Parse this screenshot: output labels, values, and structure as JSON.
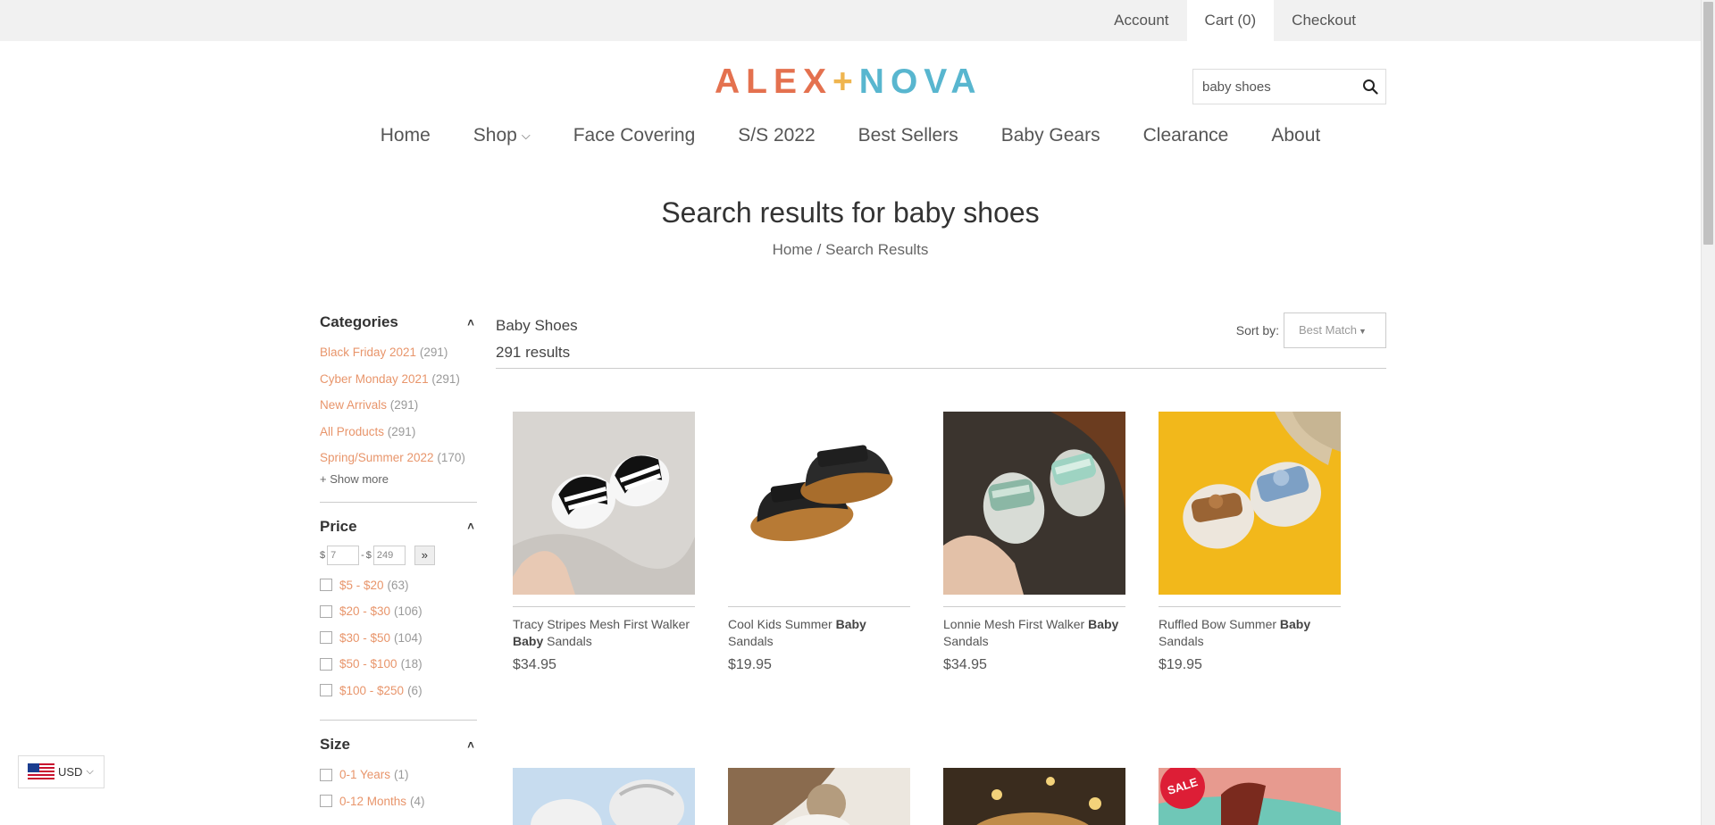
{
  "topbar": {
    "account": "Account",
    "cart": "Cart (0)",
    "checkout": "Checkout"
  },
  "logo": {
    "part1": "ALEX",
    "plus": "+",
    "part2": "NOVA"
  },
  "search": {
    "value": "baby shoes",
    "icon": "search-icon"
  },
  "nav": {
    "items": [
      "Home",
      "Shop",
      "Face Covering",
      "S/S 2022",
      "Best Sellers",
      "Baby Gears",
      "Clearance",
      "About"
    ],
    "shop_chevron": "⌵"
  },
  "page": {
    "title": "Search results for baby shoes",
    "breadcrumb_home": "Home",
    "breadcrumb_sep": " / ",
    "breadcrumb_current": "Search Results"
  },
  "sidebar": {
    "categories": {
      "title": "Categories",
      "items": [
        {
          "label": "Black Friday 2021",
          "count": "(291)"
        },
        {
          "label": "Cyber Monday 2021",
          "count": "(291)"
        },
        {
          "label": "New Arrivals",
          "count": "(291)"
        },
        {
          "label": "All Products",
          "count": "(291)"
        },
        {
          "label": "Spring/Summer 2022",
          "count": "(170)"
        }
      ],
      "show_more": "+ Show more"
    },
    "price": {
      "title": "Price",
      "currency_symbol": "$",
      "dash": "-",
      "min_value": "7",
      "max_value": "249",
      "go_label": "»",
      "ranges": [
        {
          "label": "$5 - $20",
          "count": "(63)"
        },
        {
          "label": "$20 - $30",
          "count": "(106)"
        },
        {
          "label": "$30 - $50",
          "count": "(104)"
        },
        {
          "label": "$50 - $100",
          "count": "(18)"
        },
        {
          "label": "$100 - $250",
          "count": "(6)"
        }
      ]
    },
    "size": {
      "title": "Size",
      "items": [
        {
          "label": "0-1 Years",
          "count": "(1)"
        },
        {
          "label": "0-12 Months",
          "count": "(4)"
        }
      ]
    },
    "toggle_icon": "chevron-up-icon"
  },
  "results": {
    "collection": "Baby Shoes",
    "count": "291 results",
    "sort_label": "Sort by:",
    "sort_value": "Best Match"
  },
  "products": [
    {
      "name_before": "Tracy Stripes Mesh First Walker ",
      "name_bold": "Baby",
      "name_after": " Sandals",
      "price": "$34.95"
    },
    {
      "name_before": "Cool Kids Summer ",
      "name_bold": "Baby",
      "name_after": " Sandals",
      "price": "$19.95"
    },
    {
      "name_before": "Lonnie Mesh First Walker ",
      "name_bold": "Baby",
      "name_after": " Sandals",
      "price": "$34.95"
    },
    {
      "name_before": "Ruffled Bow Summer ",
      "name_bold": "Baby",
      "name_after": " Sandals",
      "price": "$19.95"
    }
  ],
  "second_row": {
    "sale_badge": "SALE"
  },
  "currency": {
    "code": "USD",
    "chevron": "⌵"
  }
}
